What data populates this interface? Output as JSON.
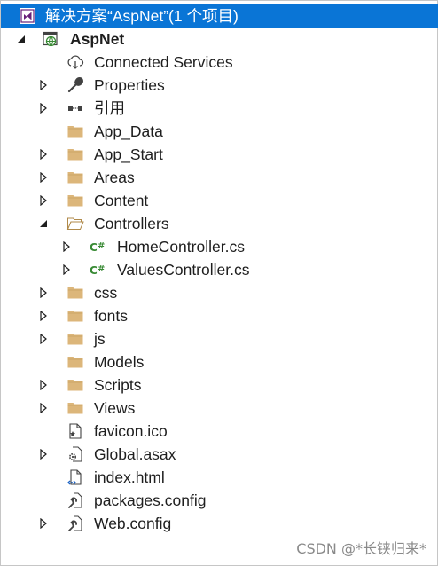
{
  "solution": {
    "label": "解决方案“AspNet”(1 个项目)",
    "icon": "visual-studio-solution-icon"
  },
  "project": {
    "label": "AspNet",
    "icon": "web-project-icon",
    "expanded": true
  },
  "items": [
    {
      "label": "Connected Services",
      "icon": "connected-services-icon",
      "expander": "none"
    },
    {
      "label": "Properties",
      "icon": "wrench-icon",
      "expander": "collapsed"
    },
    {
      "label": "引用",
      "icon": "references-icon",
      "expander": "collapsed"
    },
    {
      "label": "App_Data",
      "icon": "folder-icon",
      "expander": "none"
    },
    {
      "label": "App_Start",
      "icon": "folder-icon",
      "expander": "collapsed"
    },
    {
      "label": "Areas",
      "icon": "folder-icon",
      "expander": "collapsed"
    },
    {
      "label": "Content",
      "icon": "folder-icon",
      "expander": "collapsed"
    },
    {
      "label": "Controllers",
      "icon": "folder-open-icon",
      "expander": "expanded",
      "children": [
        {
          "label": "HomeController.cs",
          "icon": "csharp-file-icon",
          "expander": "collapsed"
        },
        {
          "label": "ValuesController.cs",
          "icon": "csharp-file-icon",
          "expander": "collapsed"
        }
      ]
    },
    {
      "label": "css",
      "icon": "folder-icon",
      "expander": "collapsed"
    },
    {
      "label": "fonts",
      "icon": "folder-icon",
      "expander": "collapsed"
    },
    {
      "label": "js",
      "icon": "folder-icon",
      "expander": "collapsed"
    },
    {
      "label": "Models",
      "icon": "folder-icon",
      "expander": "none"
    },
    {
      "label": "Scripts",
      "icon": "folder-icon",
      "expander": "collapsed"
    },
    {
      "label": "Views",
      "icon": "folder-icon",
      "expander": "collapsed"
    },
    {
      "label": "favicon.ico",
      "icon": "image-file-icon",
      "expander": "none"
    },
    {
      "label": "Global.asax",
      "icon": "asax-gear-file-icon",
      "expander": "collapsed"
    },
    {
      "label": "index.html",
      "icon": "html-file-icon",
      "expander": "none"
    },
    {
      "label": "packages.config",
      "icon": "config-file-icon",
      "expander": "none"
    },
    {
      "label": "Web.config",
      "icon": "config-file-icon",
      "expander": "collapsed"
    }
  ],
  "watermark": "CSDN @*长铗归来*",
  "colors": {
    "selection": "#0a75d6",
    "folder": "#dcb67a",
    "csharp": "#388a34",
    "text": "#1e1e1e"
  }
}
